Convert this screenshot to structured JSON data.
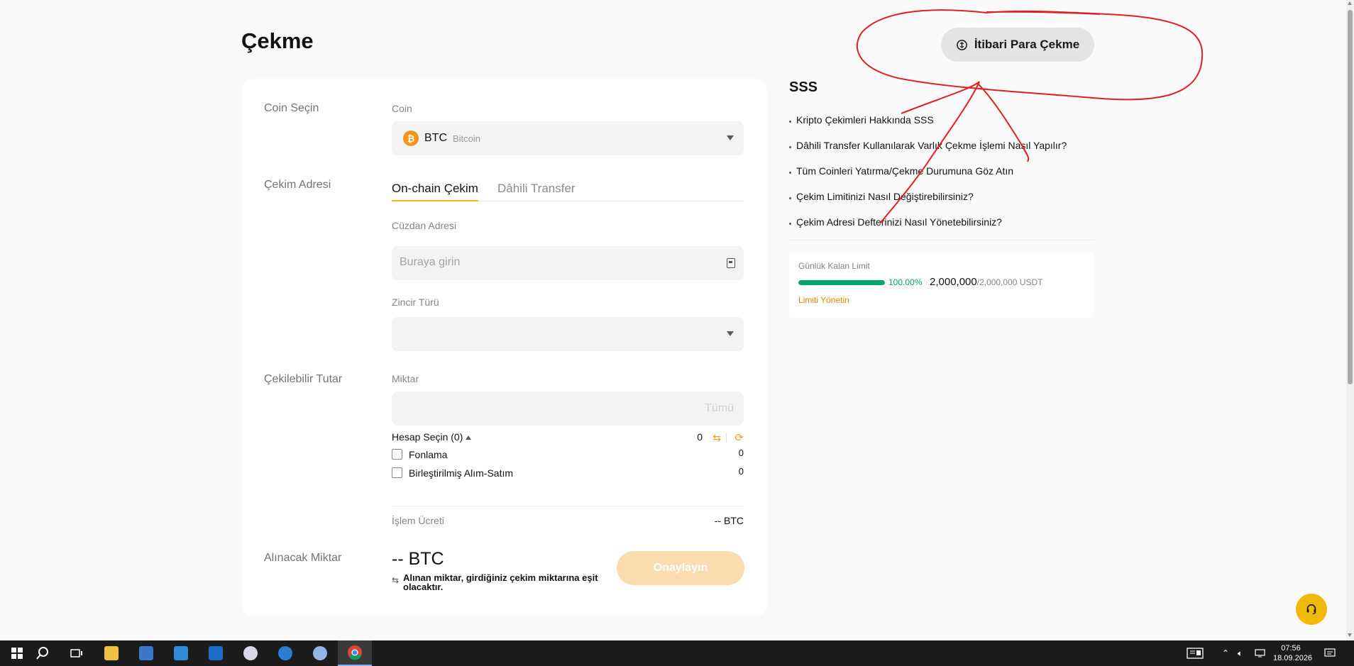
{
  "page": {
    "title": "Çekme",
    "fiat_button_label": "İtibari Para Çekme"
  },
  "form": {
    "coin_section_label": "Coin Seçin",
    "coin_field_label": "Coin",
    "coin_symbol": "BTC",
    "coin_name": "Bitcoin",
    "address_section_label": "Çekim Adresi",
    "tabs": [
      {
        "label": "On-chain Çekim",
        "active": true
      },
      {
        "label": "Dâhili Transfer",
        "active": false
      }
    ],
    "wallet_field_label": "Cüzdan Adresi",
    "wallet_placeholder": "Buraya girin",
    "chain_field_label": "Zincir Türü",
    "withdrawable_section_label": "Çekilebilir Tutar",
    "amount_field_label": "Miktar",
    "amount_all_label": "Tümü",
    "account_select_label": "Hesap Seçin (0)",
    "account_total": "0",
    "accounts": [
      {
        "label": "Fonlama",
        "value": "0"
      },
      {
        "label": "Birleştirilmiş Alım-Satım",
        "value": "0"
      }
    ],
    "fee_label": "İşlem Ücreti",
    "fee_value": "-- BTC",
    "receive_section_label": "Alınacak Miktar",
    "receive_amount": "-- BTC",
    "receive_note": "Alınan miktar, girdiğiniz çekim miktarına eşit olacaktır.",
    "confirm_button": "Onaylayın"
  },
  "faq": {
    "title": "SSS",
    "items": [
      "Kripto Çekimleri Hakkında SSS",
      "Dâhili Transfer Kullanılarak Varlık Çekme İşlemi Nasıl Yapılır?",
      "Tüm Coinleri Yatırma/Çekme Durumuna Göz Atın",
      "Çekim Limitinizi Nasıl Değiştirebilirsiniz?",
      "Çekim Adresi Defterinizi Nasıl Yönetebilirsiniz?"
    ]
  },
  "limit": {
    "label": "Günlük Kalan Limit",
    "percent": "100.00%",
    "percent_value": 1.0,
    "remaining": "2,000,000",
    "total": "/2,000,000 USDT",
    "manage_link": "Limiti Yönetin"
  },
  "taskbar": {
    "time": "07:56",
    "date": "18.09.2026"
  },
  "colors": {
    "accent": "#f0b90b",
    "success": "#03a66d",
    "link": "#e08a00",
    "annotation": "#e02020"
  }
}
